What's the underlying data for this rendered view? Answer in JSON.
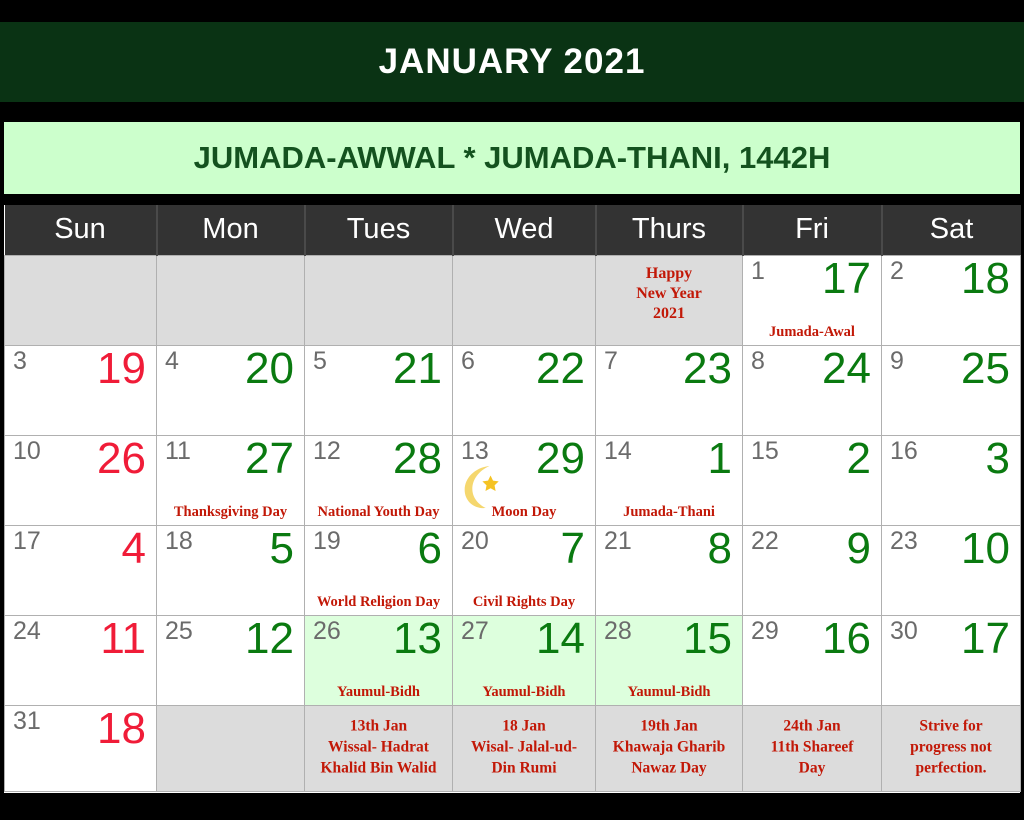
{
  "header": {
    "month_year": "JANUARY  2021",
    "hijri_months": "JUMADA-AWWAL * JUMADA-THANI, 1442H",
    "banner_color": "#0a3314",
    "hijri_banner_color": "#ccffcc",
    "hijri_text_color": "#14521f"
  },
  "weekday_headers": [
    "Sun",
    "Mon",
    "Tues",
    "Wed",
    "Thurs",
    "Fri",
    "Sat"
  ],
  "colors": {
    "weekday_header_bg": "#333333",
    "sunday_number": "#f01c38",
    "weekday_number": "#0a7a10",
    "gregorian_number": "#6b6b6b",
    "event_text": "#c21807",
    "highlight_cell": "#ddffdd",
    "empty_cell": "#dcdcdc",
    "moon_icon": "#f5d76e"
  },
  "weeks": [
    [
      {
        "empty": true
      },
      {
        "empty": true
      },
      {
        "empty": true
      },
      {
        "empty": true
      },
      {
        "empty": true,
        "multiline_event": [
          "Happy",
          "New Year",
          "2021"
        ]
      },
      {
        "gregorian": "1",
        "hijri": "17",
        "event": "Jumada-Awal"
      },
      {
        "gregorian": "2",
        "hijri": "18"
      }
    ],
    [
      {
        "gregorian": "3",
        "hijri": "19",
        "sunday": true
      },
      {
        "gregorian": "4",
        "hijri": "20"
      },
      {
        "gregorian": "5",
        "hijri": "21"
      },
      {
        "gregorian": "6",
        "hijri": "22"
      },
      {
        "gregorian": "7",
        "hijri": "23"
      },
      {
        "gregorian": "8",
        "hijri": "24"
      },
      {
        "gregorian": "9",
        "hijri": "25"
      }
    ],
    [
      {
        "gregorian": "10",
        "hijri": "26",
        "sunday": true
      },
      {
        "gregorian": "11",
        "hijri": "27",
        "event": "Thanksgiving Day"
      },
      {
        "gregorian": "12",
        "hijri": "28",
        "event": "National Youth Day"
      },
      {
        "gregorian": "13",
        "hijri": "29",
        "event": "Moon Day",
        "moon": true
      },
      {
        "gregorian": "14",
        "hijri": "1",
        "event": "Jumada-Thani"
      },
      {
        "gregorian": "15",
        "hijri": "2"
      },
      {
        "gregorian": "16",
        "hijri": "3"
      }
    ],
    [
      {
        "gregorian": "17",
        "hijri": "4",
        "sunday": true
      },
      {
        "gregorian": "18",
        "hijri": "5"
      },
      {
        "gregorian": "19",
        "hijri": "6",
        "event": "World Religion Day"
      },
      {
        "gregorian": "20",
        "hijri": "7",
        "event": "Civil Rights Day"
      },
      {
        "gregorian": "21",
        "hijri": "8"
      },
      {
        "gregorian": "22",
        "hijri": "9"
      },
      {
        "gregorian": "23",
        "hijri": "10"
      }
    ],
    [
      {
        "gregorian": "24",
        "hijri": "11",
        "sunday": true
      },
      {
        "gregorian": "25",
        "hijri": "12"
      },
      {
        "gregorian": "26",
        "hijri": "13",
        "event": "Yaumul-Bidh",
        "highlight": true
      },
      {
        "gregorian": "27",
        "hijri": "14",
        "event": "Yaumul-Bidh",
        "highlight": true
      },
      {
        "gregorian": "28",
        "hijri": "15",
        "event": "Yaumul-Bidh",
        "highlight": true
      },
      {
        "gregorian": "29",
        "hijri": "16"
      },
      {
        "gregorian": "30",
        "hijri": "17"
      }
    ]
  ],
  "notes_row": [
    {
      "gregorian": "31",
      "hijri": "18",
      "sunday": true
    },
    {
      "empty": true
    },
    {
      "note": [
        "13th Jan",
        "Wissal- Hadrat",
        "Khalid Bin Walid"
      ]
    },
    {
      "note": [
        "18 Jan",
        "Wisal- Jalal-ud-",
        "Din Rumi"
      ]
    },
    {
      "note": [
        "19th Jan",
        "Khawaja Gharib",
        "Nawaz Day"
      ]
    },
    {
      "note": [
        "24th Jan",
        "11th Shareef",
        "Day"
      ]
    },
    {
      "note": [
        "Strive for",
        "progress not",
        "perfection."
      ]
    }
  ]
}
